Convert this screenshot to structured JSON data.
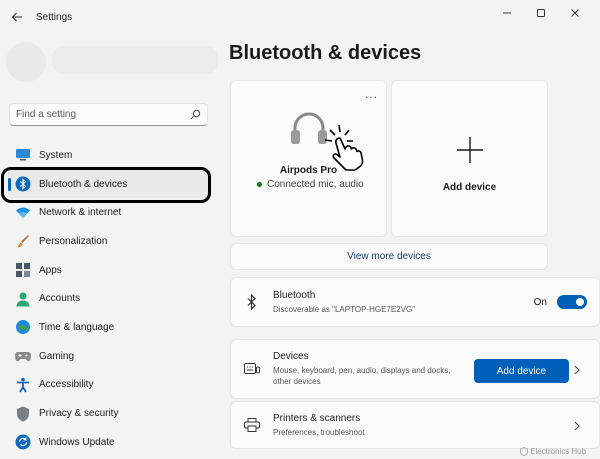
{
  "window": {
    "title": "Settings"
  },
  "search": {
    "placeholder": "Find a setting"
  },
  "sidebar": {
    "items": [
      {
        "label": "System",
        "icon": "monitor-icon"
      },
      {
        "label": "Bluetooth & devices",
        "icon": "bluetooth-icon",
        "active": true
      },
      {
        "label": "Network & internet",
        "icon": "wifi-icon"
      },
      {
        "label": "Personalization",
        "icon": "brush-icon"
      },
      {
        "label": "Apps",
        "icon": "apps-icon"
      },
      {
        "label": "Accounts",
        "icon": "person-icon"
      },
      {
        "label": "Time & language",
        "icon": "globe-icon"
      },
      {
        "label": "Gaming",
        "icon": "gamepad-icon"
      },
      {
        "label": "Accessibility",
        "icon": "accessibility-icon"
      },
      {
        "label": "Privacy & security",
        "icon": "shield-icon"
      },
      {
        "label": "Windows Update",
        "icon": "update-icon"
      }
    ]
  },
  "main": {
    "title": "Bluetooth & devices",
    "device_card": {
      "name": "Airpods Pro",
      "status": "Connected mic, audio",
      "more": "..."
    },
    "add_card": {
      "label": "Add device"
    },
    "view_more": "View more devices",
    "bluetooth_row": {
      "title": "Bluetooth",
      "subtitle": "Discoverable as \"LAPTOP-HGE7E2VG\"",
      "toggle_label": "On",
      "toggle_on": true
    },
    "devices_row": {
      "title": "Devices",
      "subtitle": "Mouse, keyboard, pen, audio, displays and docks, other devices",
      "button": "Add device"
    },
    "printers_row": {
      "title": "Printers & scanners",
      "subtitle": "Preferences, troubleshoot"
    }
  },
  "watermark": {
    "brand": "Electronics",
    "suffix": "Hub"
  },
  "colors": {
    "accent": "#005fb8",
    "highlight_ring": "#000000",
    "status_green": "#0f7b0f"
  }
}
